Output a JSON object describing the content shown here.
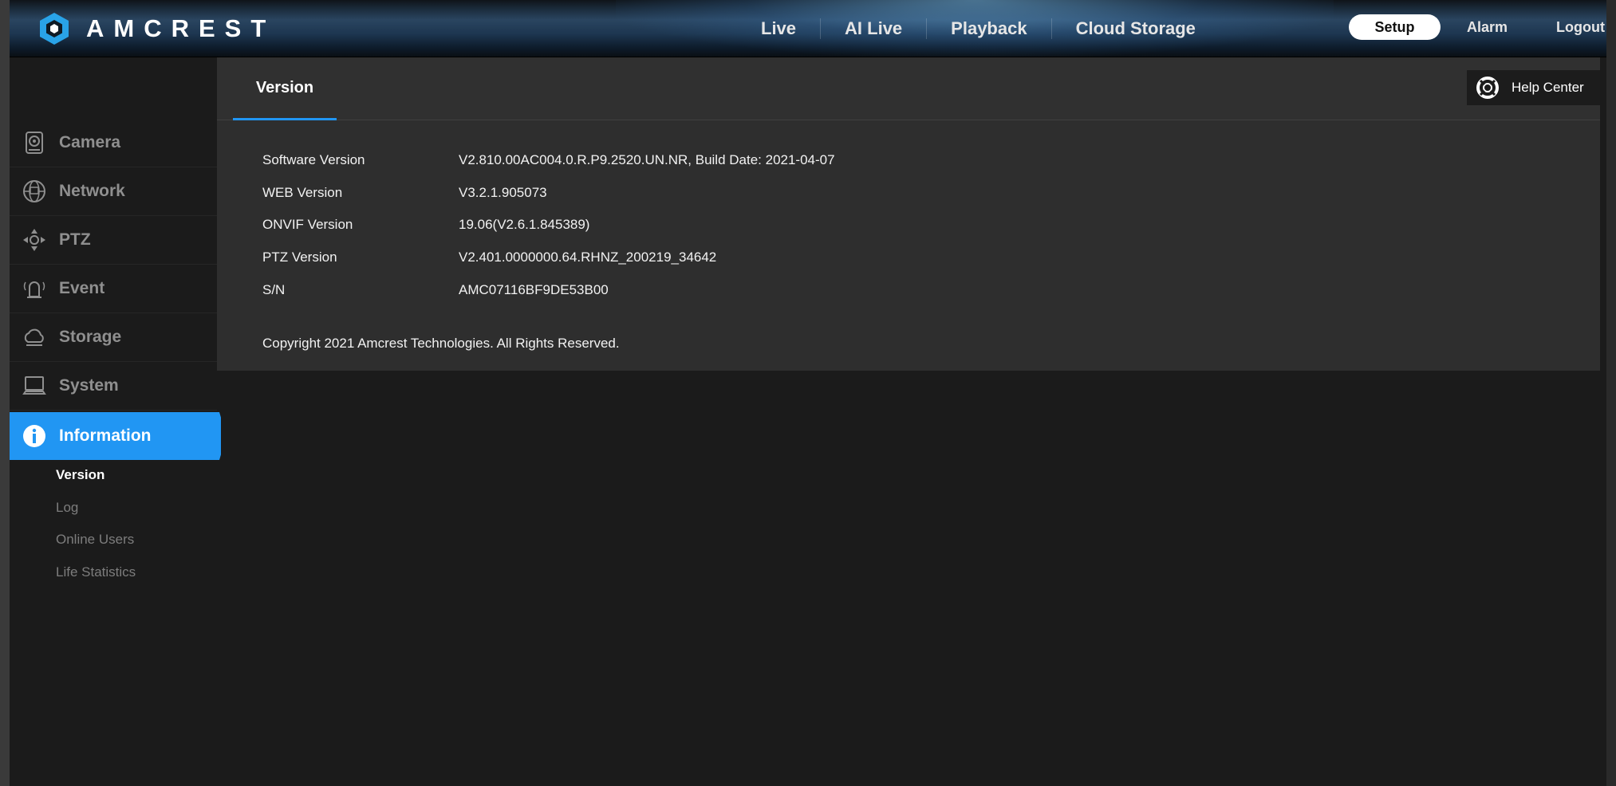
{
  "brand": {
    "name": "AMCREST"
  },
  "topnav": {
    "items": [
      "Live",
      "AI Live",
      "Playback",
      "Cloud Storage"
    ],
    "setup": "Setup",
    "alarm": "Alarm",
    "logout": "Logout"
  },
  "sidebar": {
    "items": [
      {
        "label": "Camera",
        "icon": "camera-icon"
      },
      {
        "label": "Network",
        "icon": "network-icon"
      },
      {
        "label": "PTZ",
        "icon": "ptz-icon"
      },
      {
        "label": "Event",
        "icon": "event-icon"
      },
      {
        "label": "Storage",
        "icon": "storage-icon"
      },
      {
        "label": "System",
        "icon": "system-icon"
      },
      {
        "label": "Information",
        "icon": "info-icon",
        "active": true
      }
    ],
    "subitems": [
      {
        "label": "Version",
        "active": true
      },
      {
        "label": "Log"
      },
      {
        "label": "Online Users"
      },
      {
        "label": "Life Statistics"
      }
    ]
  },
  "main": {
    "tab": "Version",
    "help": "Help Center",
    "rows": [
      {
        "label": "Software Version",
        "value": "V2.810.00AC004.0.R.P9.2520.UN.NR, Build Date: 2021-04-07"
      },
      {
        "label": "WEB Version",
        "value": "V3.2.1.905073"
      },
      {
        "label": "ONVIF Version",
        "value": "19.06(V2.6.1.845389)"
      },
      {
        "label": "PTZ Version",
        "value": "V2.401.0000000.64.RHNZ_200219_34642"
      },
      {
        "label": "S/N",
        "value": "AMC07116BF9DE53B00"
      }
    ],
    "copyright": "Copyright 2021 Amcrest Technologies. All Rights Reserved."
  },
  "colors": {
    "accent": "#2196f3",
    "background": "#1b1b1b",
    "panel": "#2e2e2e"
  }
}
